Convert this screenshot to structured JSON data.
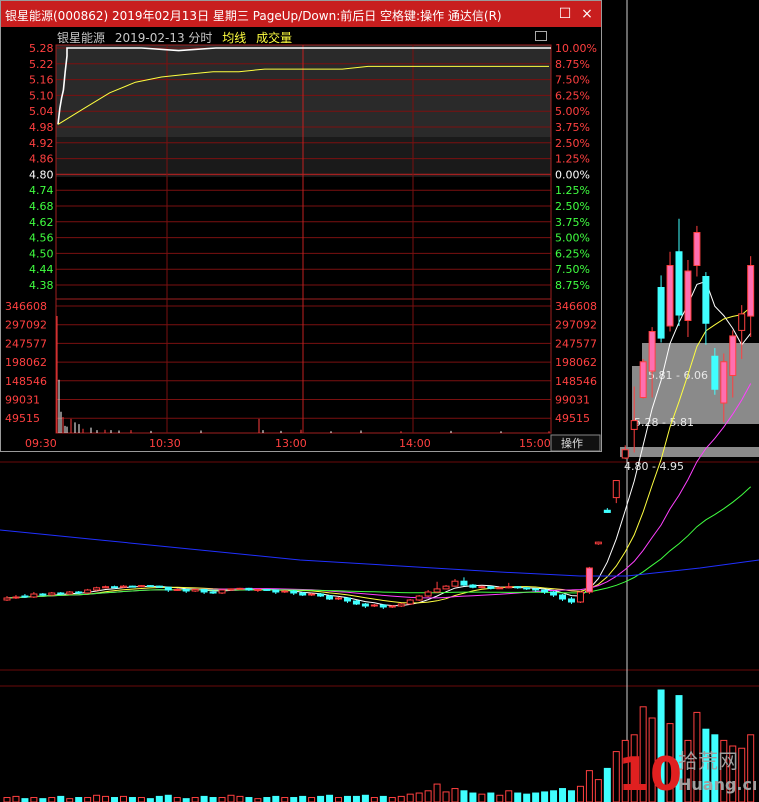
{
  "window": {
    "title": "银星能源(000862) 2019年02月13日 星期三 PageUp/Down:前后日 空格键:操作 通达信(R)",
    "close_glyph": "×"
  },
  "subheader": {
    "stock_name": "银星能源",
    "date_label": "2019-02-13 分时",
    "avg_line_label": "均线",
    "volume_label": "成交量"
  },
  "price_axis": {
    "base_price": 4.8,
    "left_ticks": [
      "5.28",
      "5.22",
      "5.16",
      "5.10",
      "5.04",
      "4.98",
      "4.92",
      "4.86",
      "4.80",
      "4.74",
      "4.68",
      "4.62",
      "4.56",
      "4.50",
      "4.44",
      "4.38"
    ],
    "right_ticks": [
      "10.00%",
      "8.75%",
      "7.50%",
      "6.25%",
      "5.00%",
      "3.75%",
      "2.50%",
      "1.25%",
      "0.00%",
      "1.25%",
      "2.50%",
      "3.75%",
      "5.00%",
      "6.25%",
      "7.50%",
      "8.75%"
    ]
  },
  "volume_axis": {
    "ticks": [
      "346608",
      "297092",
      "247577",
      "198062",
      "148546",
      "99031",
      "49515"
    ]
  },
  "time_axis": {
    "labels": [
      "09:30",
      "10:30",
      "13:00",
      "14:00",
      "15:00"
    ]
  },
  "action_button": {
    "label": "操作"
  },
  "price_line": {
    "values": [
      4.99,
      5.05,
      5.09,
      5.12,
      5.19,
      5.25,
      5.28,
      5.28,
      5.28,
      5.27,
      5.28,
      5.28,
      5.28,
      5.28,
      5.28,
      5.28,
      5.28,
      5.28,
      5.28,
      5.28
    ]
  },
  "avg_line": {
    "values": [
      4.99,
      5.05,
      5.11,
      5.15,
      5.17,
      5.18,
      5.19,
      5.19,
      5.2,
      5.2,
      5.2,
      5.2,
      5.21,
      5.21,
      5.21,
      5.21,
      5.21,
      5.21,
      5.21,
      5.21
    ]
  },
  "intraday_volume": {
    "values": [
      330000,
      150000,
      60000,
      45000,
      20000,
      18000,
      40000,
      30000,
      25000,
      12000,
      15000,
      8000,
      9000,
      8000,
      7000,
      8000,
      6000,
      7000,
      40000,
      8000,
      6000,
      9000,
      5000,
      7000,
      5000,
      6000,
      5000,
      5000
    ]
  },
  "price_zones": [
    {
      "label": "5.81 - 6.06"
    },
    {
      "label": "5.28 - 5.81"
    },
    {
      "label": "4.80 - 4.95"
    }
  ],
  "watermark": {
    "brand": "10",
    "text_top": "拾荒网",
    "text_bottom": "Huang.cn"
  },
  "colors": {
    "up": "#ff4040",
    "down": "#40ffff",
    "price_line": "#ffffff",
    "avg_line": "#ffff40",
    "grid": "#7a1010",
    "titlebar": "#c81e1e",
    "daily_ma_blue": "#2030ff"
  },
  "daily_candles": [
    {
      "o": 4.3,
      "c": 4.32,
      "h": 4.34,
      "l": 4.29
    },
    {
      "o": 4.32,
      "c": 4.33,
      "h": 4.35,
      "l": 4.31
    },
    {
      "o": 4.34,
      "c": 4.33,
      "h": 4.36,
      "l": 4.32
    },
    {
      "o": 4.33,
      "c": 4.36,
      "h": 4.38,
      "l": 4.32
    },
    {
      "o": 4.36,
      "c": 4.35,
      "h": 4.37,
      "l": 4.34
    },
    {
      "o": 4.35,
      "c": 4.37,
      "h": 4.38,
      "l": 4.34
    },
    {
      "o": 4.37,
      "c": 4.36,
      "h": 4.38,
      "l": 4.35
    },
    {
      "o": 4.36,
      "c": 4.38,
      "h": 4.39,
      "l": 4.35
    },
    {
      "o": 4.38,
      "c": 4.37,
      "h": 4.39,
      "l": 4.36
    },
    {
      "o": 4.37,
      "c": 4.4,
      "h": 4.42,
      "l": 4.36
    },
    {
      "o": 4.4,
      "c": 4.44,
      "h": 4.46,
      "l": 4.39
    },
    {
      "o": 4.44,
      "c": 4.46,
      "h": 4.48,
      "l": 4.43
    },
    {
      "o": 4.46,
      "c": 4.45,
      "h": 4.48,
      "l": 4.44
    },
    {
      "o": 4.45,
      "c": 4.47,
      "h": 4.49,
      "l": 4.44
    },
    {
      "o": 4.47,
      "c": 4.46,
      "h": 4.48,
      "l": 4.45
    },
    {
      "o": 4.46,
      "c": 4.48,
      "h": 4.49,
      "l": 4.45
    },
    {
      "o": 4.48,
      "c": 4.47,
      "h": 4.49,
      "l": 4.46
    },
    {
      "o": 4.47,
      "c": 4.45,
      "h": 4.48,
      "l": 4.44
    },
    {
      "o": 4.45,
      "c": 4.4,
      "h": 4.46,
      "l": 4.38
    },
    {
      "o": 4.4,
      "c": 4.41,
      "h": 4.43,
      "l": 4.39
    },
    {
      "o": 4.41,
      "c": 4.39,
      "h": 4.42,
      "l": 4.37
    },
    {
      "o": 4.39,
      "c": 4.41,
      "h": 4.42,
      "l": 4.38
    },
    {
      "o": 4.41,
      "c": 4.38,
      "h": 4.42,
      "l": 4.36
    },
    {
      "o": 4.38,
      "c": 4.37,
      "h": 4.4,
      "l": 4.36
    },
    {
      "o": 4.37,
      "c": 4.4,
      "h": 4.41,
      "l": 4.36
    },
    {
      "o": 4.4,
      "c": 4.42,
      "h": 4.43,
      "l": 4.39
    },
    {
      "o": 4.42,
      "c": 4.43,
      "h": 4.44,
      "l": 4.41
    },
    {
      "o": 4.43,
      "c": 4.4,
      "h": 4.44,
      "l": 4.39
    },
    {
      "o": 4.4,
      "c": 4.41,
      "h": 4.42,
      "l": 4.38
    },
    {
      "o": 4.41,
      "c": 4.4,
      "h": 4.42,
      "l": 4.39
    },
    {
      "o": 4.4,
      "c": 4.38,
      "h": 4.41,
      "l": 4.36
    },
    {
      "o": 4.38,
      "c": 4.39,
      "h": 4.4,
      "l": 4.37
    },
    {
      "o": 4.39,
      "c": 4.37,
      "h": 4.4,
      "l": 4.35
    },
    {
      "o": 4.37,
      "c": 4.35,
      "h": 4.38,
      "l": 4.34
    },
    {
      "o": 4.35,
      "c": 4.36,
      "h": 4.37,
      "l": 4.34
    },
    {
      "o": 4.36,
      "c": 4.34,
      "h": 4.37,
      "l": 4.33
    },
    {
      "o": 4.34,
      "c": 4.31,
      "h": 4.35,
      "l": 4.3
    },
    {
      "o": 4.31,
      "c": 4.32,
      "h": 4.33,
      "l": 4.3
    },
    {
      "o": 4.32,
      "c": 4.29,
      "h": 4.33,
      "l": 4.27
    },
    {
      "o": 4.29,
      "c": 4.26,
      "h": 4.3,
      "l": 4.25
    },
    {
      "o": 4.26,
      "c": 4.24,
      "h": 4.27,
      "l": 4.22
    },
    {
      "o": 4.24,
      "c": 4.25,
      "h": 4.26,
      "l": 4.23
    },
    {
      "o": 4.25,
      "c": 4.23,
      "h": 4.26,
      "l": 4.21
    },
    {
      "o": 4.23,
      "c": 4.24,
      "h": 4.25,
      "l": 4.22
    },
    {
      "o": 4.24,
      "c": 4.26,
      "h": 4.27,
      "l": 4.23
    },
    {
      "o": 4.26,
      "c": 4.3,
      "h": 4.31,
      "l": 4.25
    },
    {
      "o": 4.3,
      "c": 4.34,
      "h": 4.35,
      "l": 4.29
    },
    {
      "o": 4.34,
      "c": 4.38,
      "h": 4.4,
      "l": 4.33
    },
    {
      "o": 4.38,
      "c": 4.42,
      "h": 4.55,
      "l": 4.37
    },
    {
      "o": 4.42,
      "c": 4.47,
      "h": 4.49,
      "l": 4.41
    },
    {
      "o": 4.47,
      "c": 4.56,
      "h": 4.6,
      "l": 4.46
    },
    {
      "o": 4.56,
      "c": 4.49,
      "h": 4.63,
      "l": 4.47
    },
    {
      "o": 4.49,
      "c": 4.45,
      "h": 4.51,
      "l": 4.43
    },
    {
      "o": 4.45,
      "c": 4.46,
      "h": 4.48,
      "l": 4.43
    },
    {
      "o": 4.46,
      "c": 4.43,
      "h": 4.47,
      "l": 4.41
    },
    {
      "o": 4.43,
      "c": 4.44,
      "h": 4.46,
      "l": 4.42
    },
    {
      "o": 4.44,
      "c": 4.46,
      "h": 4.53,
      "l": 4.43
    },
    {
      "o": 4.46,
      "c": 4.44,
      "h": 4.47,
      "l": 4.42
    },
    {
      "o": 4.44,
      "c": 4.42,
      "h": 4.45,
      "l": 4.4
    },
    {
      "o": 4.42,
      "c": 4.4,
      "h": 4.43,
      "l": 4.38
    },
    {
      "o": 4.4,
      "c": 4.38,
      "h": 4.41,
      "l": 4.36
    },
    {
      "o": 4.38,
      "c": 4.35,
      "h": 4.39,
      "l": 4.33
    },
    {
      "o": 4.35,
      "c": 4.31,
      "h": 4.36,
      "l": 4.29
    },
    {
      "o": 4.31,
      "c": 4.28,
      "h": 4.33,
      "l": 4.26
    },
    {
      "o": 4.28,
      "c": 4.38,
      "h": 4.39,
      "l": 4.27
    },
    {
      "o": 4.38,
      "c": 4.8,
      "h": 4.82,
      "l": 4.36
    },
    {
      "o": 5.24,
      "c": 5.27,
      "h": 5.28,
      "l": 5.22
    },
    {
      "o": 5.85,
      "c": 5.81,
      "h": 5.89,
      "l": 5.8
    },
    {
      "o": 6.08,
      "c": 6.39,
      "h": 6.39,
      "l": 5.98
    },
    {
      "o": 6.8,
      "c": 6.95,
      "h": 7.03,
      "l": 6.78
    },
    {
      "o": 7.32,
      "c": 7.48,
      "h": 8.1,
      "l": 6.9
    },
    {
      "o": 7.9,
      "c": 8.55,
      "h": 8.6,
      "l": 7.88
    },
    {
      "o": 8.38,
      "c": 9.1,
      "h": 9.18,
      "l": 7.9
    },
    {
      "o": 9.9,
      "c": 8.98,
      "h": 10.12,
      "l": 8.9
    },
    {
      "o": 9.2,
      "c": 10.3,
      "h": 10.55,
      "l": 9.1
    },
    {
      "o": 10.55,
      "c": 9.4,
      "h": 11.15,
      "l": 9.2
    },
    {
      "o": 9.3,
      "c": 10.2,
      "h": 10.4,
      "l": 9.0
    },
    {
      "o": 10.3,
      "c": 10.9,
      "h": 11.02,
      "l": 10.1
    },
    {
      "o": 10.1,
      "c": 9.25,
      "h": 10.18,
      "l": 8.86
    },
    {
      "o": 8.65,
      "c": 8.05,
      "h": 8.8,
      "l": 7.95
    },
    {
      "o": 7.8,
      "c": 8.55,
      "h": 8.7,
      "l": 7.45
    },
    {
      "o": 8.3,
      "c": 9.02,
      "h": 9.12,
      "l": 7.9
    },
    {
      "o": 9.12,
      "c": 9.42,
      "h": 9.58,
      "l": 8.6
    },
    {
      "o": 9.38,
      "c": 10.3,
      "h": 10.47,
      "l": 9.0
    }
  ],
  "daily_volume": {
    "values": [
      4,
      5,
      3,
      4,
      3,
      4,
      5,
      3,
      4,
      4,
      6,
      5,
      4,
      5,
      4,
      4,
      3,
      5,
      6,
      4,
      3,
      4,
      5,
      4,
      4,
      6,
      5,
      4,
      3,
      4,
      5,
      4,
      4,
      5,
      4,
      5,
      6,
      4,
      5,
      5,
      6,
      4,
      5,
      4,
      5,
      7,
      8,
      10,
      16,
      9,
      12,
      10,
      8,
      7,
      8,
      6,
      10,
      8,
      7,
      8,
      9,
      10,
      12,
      10,
      14,
      28,
      20,
      30,
      45,
      55,
      60,
      85,
      75,
      100,
      70,
      95,
      55,
      80,
      65,
      60,
      55,
      50,
      48,
      60
    ]
  }
}
